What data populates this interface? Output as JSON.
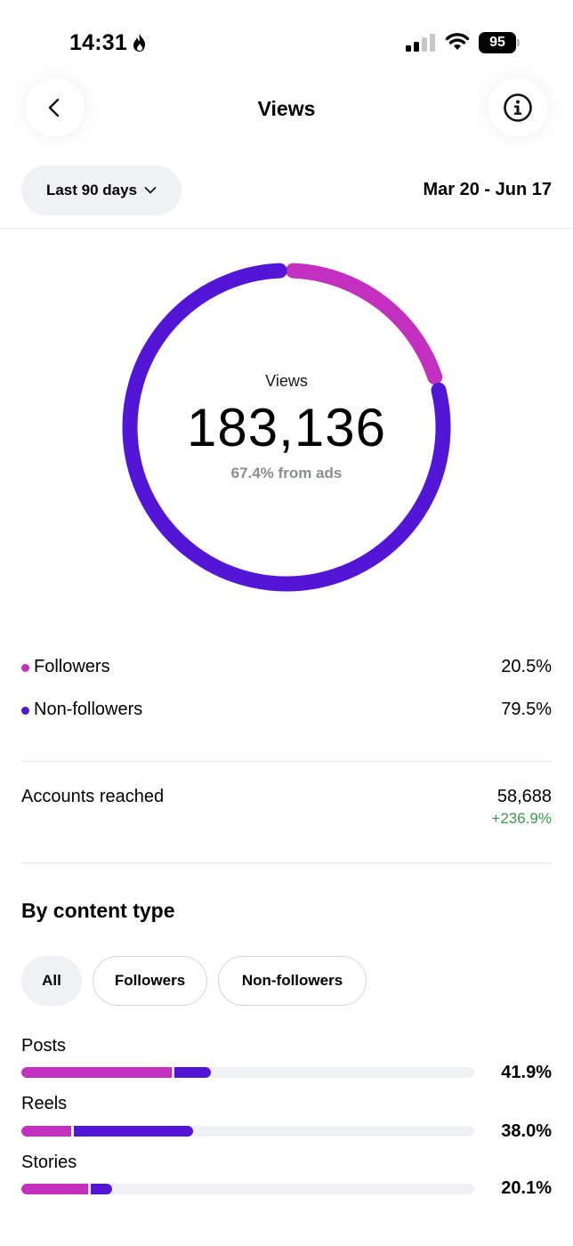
{
  "status_bar": {
    "time": "14:31",
    "battery": "95"
  },
  "header": {
    "title": "Views",
    "back_icon": "chevron-left-icon",
    "info_icon": "info-circle-icon"
  },
  "filters": {
    "range_label": "Last 90 days",
    "date_range": "Mar 20 - Jun 17"
  },
  "donut": {
    "label": "Views",
    "value": "183,136",
    "subtitle": "67.4% from ads",
    "followers_fraction": 0.205,
    "non_followers_fraction": 0.795
  },
  "legend": [
    {
      "name": "Followers",
      "value": "20.5%",
      "color": "#c330c0"
    },
    {
      "name": "Non-followers",
      "value": "79.5%",
      "color": "#5416d6"
    }
  ],
  "accounts_reached": {
    "label": "Accounts reached",
    "value": "58,688",
    "change": "+236.9%"
  },
  "content_type": {
    "title": "By content type",
    "tabs": [
      "All",
      "Followers",
      "Non-followers"
    ],
    "selected_tab": "All",
    "rows": [
      {
        "label": "Posts",
        "percent": "41.9%",
        "followers_share": 33.4,
        "non_followers_share": 8.5
      },
      {
        "label": "Reels",
        "percent": "38.0%",
        "followers_share": 11.3,
        "non_followers_share": 26.7
      },
      {
        "label": "Stories",
        "percent": "20.1%",
        "followers_share": 15.0,
        "non_followers_share": 5.1
      }
    ]
  },
  "colors": {
    "followers": "#c330c0",
    "non_followers": "#5416d6",
    "positive": "#3a9a4c",
    "muted": "#8a8d91"
  }
}
